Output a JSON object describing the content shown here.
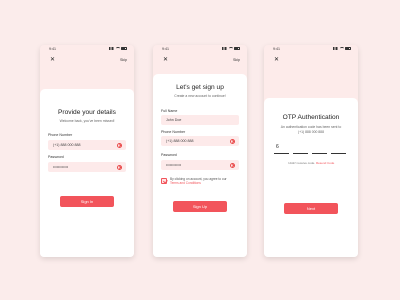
{
  "screens": [
    {
      "status_time": "9:41",
      "close_icon": "close-icon",
      "skip": "Skip",
      "title": "Provide your details",
      "subtitle": "Welcome back, you've been missed!",
      "fields": [
        {
          "label": "Phone Number",
          "value": "(+1) 888 000 888"
        },
        {
          "label": "Password",
          "value": "••••••••••••"
        }
      ],
      "button": "Sign In"
    },
    {
      "status_time": "9:41",
      "close_icon": "close-icon",
      "skip": "Skip",
      "title": "Let's get sign up",
      "subtitle": "Create a new account to continue!",
      "fields": [
        {
          "label": "Full Name",
          "value": "John Doe"
        },
        {
          "label": "Phone Number",
          "value": "(+1) 888 000 888"
        },
        {
          "label": "Password",
          "value": "••••••••••••"
        }
      ],
      "terms_prefix": "By clicking on account, you agree to our",
      "terms_link": "Terms and Conditions",
      "button": "Sign Up"
    },
    {
      "status_time": "9:41",
      "close_icon": "close-icon",
      "title": "OTP Authentication",
      "subtitle_1": "An authentication code has been sent to",
      "subtitle_2": "(+1) 888 000 888",
      "otp_digits": [
        "6",
        "",
        "",
        ""
      ],
      "resend_prefix": "I didn't receive code.",
      "resend_link": "Resend Code",
      "button": "Next"
    }
  ],
  "colors": {
    "background": "#fbeceb",
    "accent": "#f2545b",
    "field": "#fdeaea"
  }
}
